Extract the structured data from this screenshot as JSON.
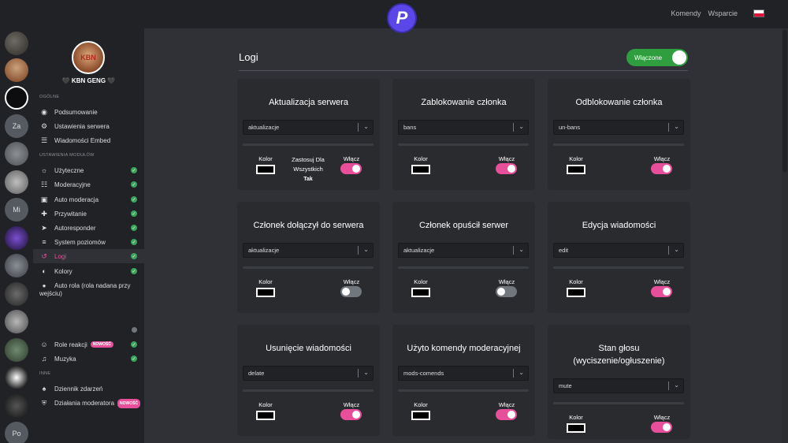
{
  "topbar": {
    "logo_letter": "P",
    "links": [
      "Komendy",
      "Wsparcie"
    ],
    "flag": "pl-flag"
  },
  "rail": [
    "",
    "",
    "",
    "Za",
    "",
    "",
    "Mi",
    "",
    "",
    "",
    "",
    "",
    "",
    "",
    "Po"
  ],
  "sidebar": {
    "guild_name": "🖤 KBN GENG 🖤",
    "avatar_text": "KBN",
    "sections": [
      {
        "title": "OGÓLNE",
        "items": [
          {
            "label": "Podsumowanie",
            "icon": "eye-icon"
          },
          {
            "label": "Ustawienia serwera",
            "icon": "gear-icon"
          },
          {
            "label": "Wiadomości Embed",
            "icon": "embed-icon"
          }
        ]
      },
      {
        "title": "USTAWIENIA MODUŁÓW",
        "items": [
          {
            "label": "Użyteczne",
            "icon": "sun-icon",
            "status": "on"
          },
          {
            "label": "Moderacyjne",
            "icon": "list-icon",
            "status": "on"
          },
          {
            "label": "Auto moderacja",
            "icon": "robot-icon",
            "status": "on"
          },
          {
            "label": "Przywitanie",
            "icon": "user-plus-icon",
            "status": "on"
          },
          {
            "label": "Autoresponder",
            "icon": "send-icon",
            "status": "on"
          },
          {
            "label": "System poziomów",
            "icon": "levels-icon",
            "status": "on"
          },
          {
            "label": "Logi",
            "icon": "history-icon",
            "status": "on",
            "active": true
          },
          {
            "label": "Kolory",
            "icon": "palette-icon",
            "status": "on"
          },
          {
            "label": "Auto rola (rola nadana przy wejściu)",
            "icon": "user-icon",
            "status": "off"
          },
          {
            "label": "Role reakcji",
            "icon": "smile-icon",
            "status": "on",
            "badge": "NOWOŚĆ"
          },
          {
            "label": "Muzyka",
            "icon": "music-icon",
            "status": "on"
          }
        ]
      },
      {
        "title": "INNE",
        "items": [
          {
            "label": "Dziennik zdarzeń",
            "icon": "bell-icon"
          },
          {
            "label": "Działania moderatora",
            "icon": "shield-icon",
            "badge": "NOWOŚĆ"
          }
        ]
      }
    ]
  },
  "main": {
    "title": "Logi",
    "toggle_label": "Włączone",
    "labels": {
      "color": "Kolor",
      "enable": "Włącz",
      "apply_all": "Zastosuj Dla Wszystkich",
      "apply_value": "Tak"
    },
    "cards": [
      {
        "title": "Aktualizacja serwera",
        "channel": "aktualizacje",
        "enabled": true,
        "apply_all": true
      },
      {
        "title": "Zablokowanie członka",
        "channel": "bans",
        "enabled": true
      },
      {
        "title": "Odblokowanie członka",
        "channel": "un-bans",
        "enabled": true
      },
      {
        "title": "Członek dołączył do serwera",
        "channel": "aktualizacje",
        "enabled": false
      },
      {
        "title": "Członek opuścił serwer",
        "channel": "aktualizacje",
        "enabled": false
      },
      {
        "title": "Edycja wiadomości",
        "channel": "edit",
        "enabled": true
      },
      {
        "title": "Usunięcie wiadomości",
        "channel": "delate",
        "enabled": true
      },
      {
        "title": "Użyto komendy moderacyjnej",
        "channel": "mods-comends",
        "enabled": true
      },
      {
        "title": "Stan głosu (wyciszenie/ogłuszenie)",
        "channel": "mute",
        "enabled": true
      }
    ]
  },
  "colors": {
    "accent": "#e84f9b",
    "success": "#3ba55d",
    "brand": "#5b47e8"
  }
}
